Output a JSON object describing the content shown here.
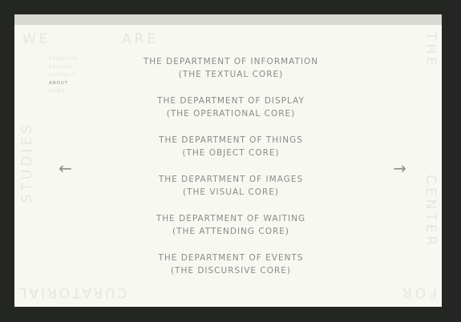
{
  "frame_words": {
    "we": "WE",
    "are": "ARE",
    "the": "THE",
    "center": "CENTER",
    "studies": "STUDIES",
    "curatorial": "CURATORIAL",
    "for": "FOR"
  },
  "nav": {
    "items": [
      {
        "label": "PROJECTS",
        "active": false
      },
      {
        "label": "ARCHIVE",
        "active": false
      },
      {
        "label": "CONTACT",
        "active": false
      },
      {
        "label": "ABOUT",
        "active": true
      },
      {
        "label": "NEWS",
        "active": false
      }
    ]
  },
  "departments": [
    {
      "name": "THE DEPARTMENT OF INFORMATION",
      "core": "(THE TEXTUAL CORE)"
    },
    {
      "name": "THE DEPARTMENT OF DISPLAY",
      "core": "(THE OPERATIONAL CORE)"
    },
    {
      "name": "THE DEPARTMENT OF THINGS",
      "core": "(THE OBJECT CORE)"
    },
    {
      "name": "THE DEPARTMENT OF IMAGES",
      "core": "(THE VISUAL CORE)"
    },
    {
      "name": "THE DEPARTMENT OF WAITING",
      "core": "(THE ATTENDING CORE)"
    },
    {
      "name": "THE DEPARTMENT OF EVENTS",
      "core": "(THE DISCURSIVE CORE)"
    }
  ],
  "arrows": {
    "prev": "←",
    "next": "→",
    "prev_icon": "arrow-left-icon",
    "next_icon": "arrow-right-icon"
  },
  "colors": {
    "background": "#242623",
    "page": "#f8f8f3",
    "top_bar": "#d7d8d2",
    "text": "#8a8b86",
    "frame_text": "#e5e6e0"
  }
}
